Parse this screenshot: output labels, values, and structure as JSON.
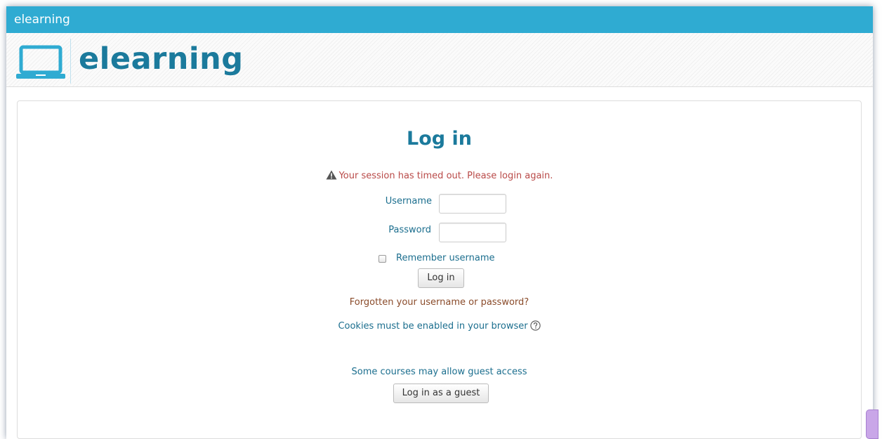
{
  "window": {
    "title": "elearning"
  },
  "brand": {
    "name": "elearning",
    "logo_icon": "laptop-icon",
    "accent_color": "#2fabd2"
  },
  "login": {
    "title": "Log in",
    "error_message": "Your session has timed out. Please login again.",
    "error_icon": "warning-icon",
    "error_color": "#b94a48",
    "username_label": "Username",
    "username_value": "",
    "password_label": "Password",
    "password_value": "",
    "remember_label": "Remember username",
    "remember_checked": false,
    "login_button": "Log in",
    "forgot_link": "Forgotten your username or password?",
    "cookies_text": "Cookies must be enabled in your browser",
    "cookies_help_icon": "help-icon",
    "guest_text": "Some courses may allow guest access",
    "guest_button": "Log in as a guest"
  }
}
